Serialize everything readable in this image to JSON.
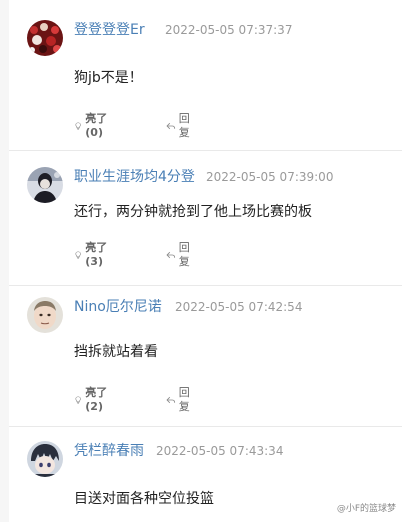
{
  "comments": [
    {
      "username": "登登登登Er",
      "timestamp": "2022-05-05 07:37:37",
      "text": "狗jb不是！",
      "like_label": "亮了(0)",
      "reply_label": "回复",
      "avatar_icon": "avatar-crowd-red"
    },
    {
      "username": "职业生涯场均4分登",
      "timestamp": "2022-05-05 07:39:00",
      "text": "还行，两分钟就抢到了他上场比赛的板",
      "like_label": "亮了(3)",
      "reply_label": "回复",
      "avatar_icon": "avatar-person-dark"
    },
    {
      "username": "Nino厄尔尼诺",
      "timestamp": "2022-05-05 07:42:54",
      "text": "挡拆就站着看",
      "like_label": "亮了(2)",
      "reply_label": "回复",
      "avatar_icon": "avatar-face"
    },
    {
      "username": "凭栏醉春雨",
      "timestamp": "2022-05-05 07:43:34",
      "text": "目送对面各种空位投篮",
      "like_label": "",
      "reply_label": "",
      "avatar_icon": "avatar-anime"
    }
  ],
  "watermark": "@小F的篮球梦",
  "colors": {
    "username": "#4a7fb5",
    "timestamp": "#9a9a9a",
    "text": "#222222",
    "action": "#666666",
    "divider": "#e9e9e9"
  }
}
